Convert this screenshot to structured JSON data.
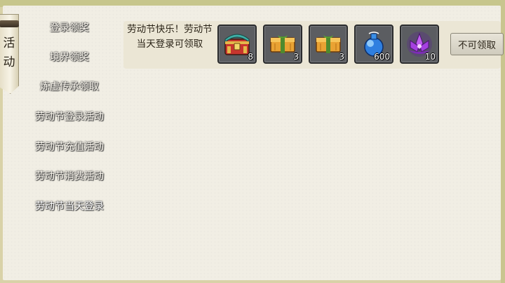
{
  "window": {
    "scroll_title": "活动"
  },
  "sidebar": {
    "items": [
      {
        "label": "登录领奖",
        "active": false
      },
      {
        "label": "境界领奖",
        "active": false
      },
      {
        "label": "炼虚传承领取",
        "active": false
      },
      {
        "label": "劳动节登录活动",
        "active": false
      },
      {
        "label": "劳动节充值活动",
        "active": false
      },
      {
        "label": "劳动节消费活动",
        "active": false
      },
      {
        "label": "劳动节当天登录",
        "active": true
      }
    ]
  },
  "reward_row": {
    "description": "劳动节快乐！劳动节当天登录可领取",
    "rewards": [
      {
        "icon": "treasure-chest-icon",
        "count": "8"
      },
      {
        "icon": "gold-bundle-icon",
        "count": "3"
      },
      {
        "icon": "gold-bundle-icon",
        "count": "3"
      },
      {
        "icon": "blue-potion-icon",
        "count": "600"
      },
      {
        "icon": "purple-lotus-icon",
        "count": "10"
      }
    ],
    "claim_button": "不可领取"
  },
  "colors": {
    "active_tab": "#e9c53a",
    "paper": "#f1eee4",
    "frame": "#c7c68c"
  }
}
